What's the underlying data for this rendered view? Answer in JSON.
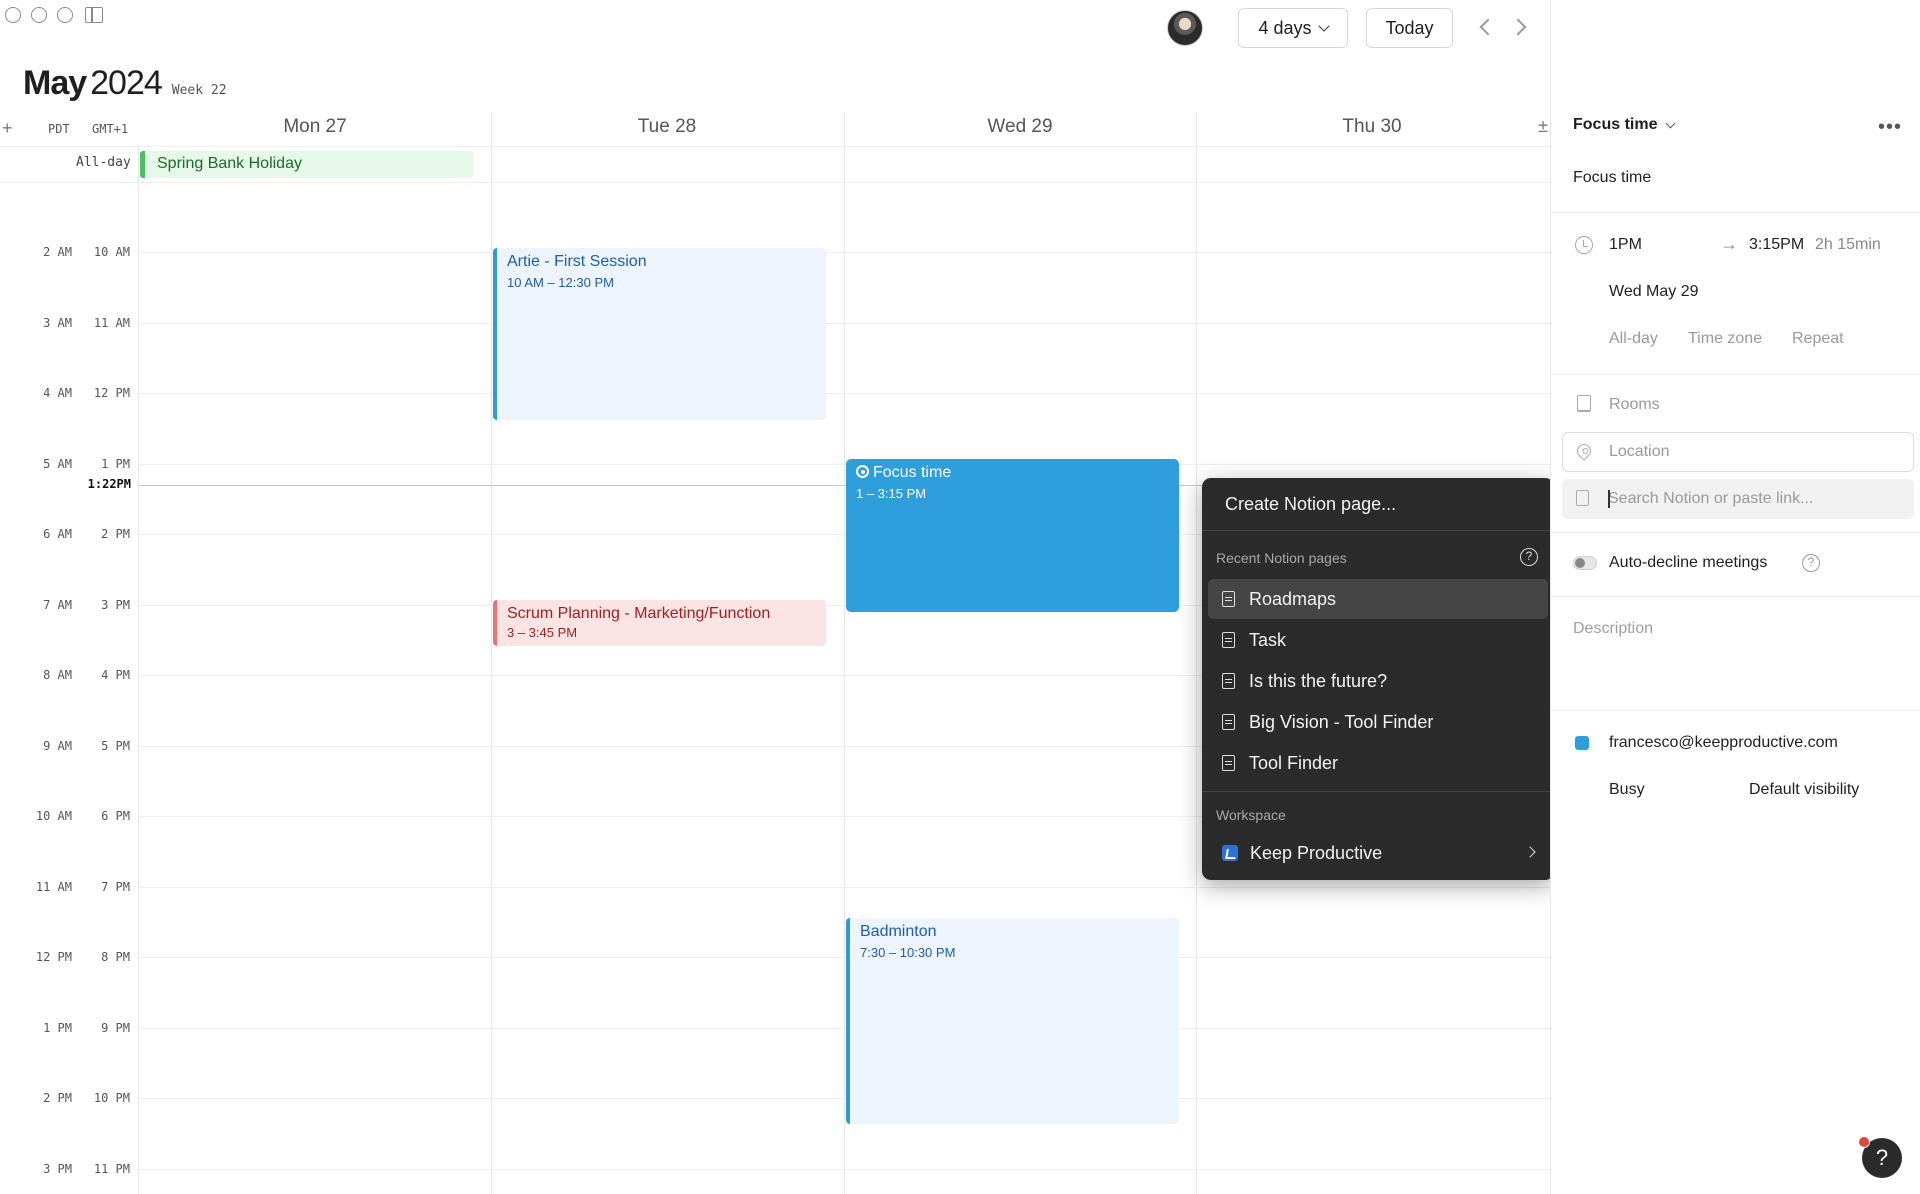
{
  "toolbar": {
    "view_label": "4 days",
    "today_label": "Today"
  },
  "header": {
    "month": "May",
    "year": "2024",
    "week": "Week 22"
  },
  "timezones": {
    "primary": "PDT",
    "secondary": "GMT+1"
  },
  "days": [
    "Mon 27",
    "Tue 28",
    "Wed 29",
    "Thu 30"
  ],
  "allday_label": "All-day",
  "time_rows": [
    {
      "pdt": "2 AM",
      "gmt": "10 AM"
    },
    {
      "pdt": "3 AM",
      "gmt": "11 AM"
    },
    {
      "pdt": "4 AM",
      "gmt": "12 PM"
    },
    {
      "pdt": "5 AM",
      "gmt": "1 PM"
    },
    {
      "pdt": "6 AM",
      "gmt": "2 PM"
    },
    {
      "pdt": "7 AM",
      "gmt": "3 PM"
    },
    {
      "pdt": "8 AM",
      "gmt": "4 PM"
    },
    {
      "pdt": "9 AM",
      "gmt": "5 PM"
    },
    {
      "pdt": "10 AM",
      "gmt": "6 PM"
    },
    {
      "pdt": "11 AM",
      "gmt": "7 PM"
    },
    {
      "pdt": "12 PM",
      "gmt": "8 PM"
    },
    {
      "pdt": "1 PM",
      "gmt": "9 PM"
    },
    {
      "pdt": "2 PM",
      "gmt": "10 PM"
    },
    {
      "pdt": "3 PM",
      "gmt": "11 PM"
    }
  ],
  "now_label": "1:22PM",
  "events": {
    "holiday": {
      "title": "Spring Bank Holiday"
    },
    "artie": {
      "title": "Artie - First Session",
      "time": "10 AM – 12:30 PM"
    },
    "focus": {
      "title": "Focus time",
      "time": "1 – 3:15 PM"
    },
    "scrum": {
      "title": "Scrum Planning - Marketing/Function",
      "time": "3 – 3:45 PM"
    },
    "badminton": {
      "title": "Badminton",
      "time": "7:30 – 10:30 PM"
    }
  },
  "popup": {
    "create_label": "Create Notion page...",
    "recent_header": "Recent Notion pages",
    "recent_pages": [
      "Roadmaps",
      "Task",
      "Is this the future?",
      "Big Vision - Tool Finder",
      "Tool Finder"
    ],
    "workspace_header": "Workspace",
    "workspace_name": "Keep Productive"
  },
  "panel": {
    "calendar_type": "Focus time",
    "event_name": "Focus time",
    "start": "1PM",
    "end": "3:15PM",
    "duration": "2h 15min",
    "date": "Wed May 29",
    "opt_allday": "All-day",
    "opt_timezone": "Time zone",
    "opt_repeat": "Repeat",
    "rooms": "Rooms",
    "location_placeholder": "Location",
    "notion_placeholder": "Search Notion or paste link...",
    "auto_decline": "Auto-decline meetings",
    "description_placeholder": "Description",
    "calendar_email": "francesco@keepproductive.com",
    "busy": "Busy",
    "visibility": "Default visibility",
    "calendar_color": "#2f9fdb"
  }
}
